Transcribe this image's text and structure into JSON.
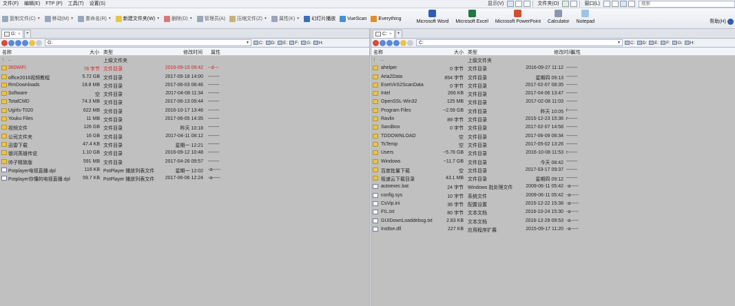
{
  "menu": {
    "items": [
      "文件(F)",
      "编辑(E)",
      "FTP (P)",
      "工具(T)",
      "设置(S)"
    ],
    "right_items": [
      "显示(V)",
      "文件夹(O)",
      "窗口(L)"
    ],
    "search_placeholder": "搜索"
  },
  "toolbar": {
    "buttons": [
      "复制文件(C)",
      "移动(M)",
      "重命名(R)",
      "新建文件夹(W)",
      "删除(D)",
      "管理员(A)",
      "压缩文件(Z)",
      "属性(K)",
      "幻灯片播放",
      "VueScan",
      "Everything"
    ],
    "apps": [
      "Microsoft Word",
      "Microsoft Excel",
      "Microsoft PowerPoint",
      "Calculator",
      "Notepad"
    ],
    "help": "帮助(H)"
  },
  "left": {
    "tab": "G:",
    "path": "G:",
    "drives": [
      "C:",
      "D:",
      "E:",
      "F:",
      "G:",
      "H:"
    ],
    "columns": {
      "name": "名称",
      "size": "大小",
      "type": "类型",
      "time": "修改时间",
      "attr": "属性"
    },
    "rows": [
      {
        "icon": "up",
        "name": "..",
        "size": "",
        "type": "上级文件夹",
        "time": "",
        "attr": "",
        "red": false
      },
      {
        "icon": "folder",
        "name": "360WiFi",
        "size": "78 字节",
        "type": "文件目录",
        "time": "2016-09-15 09:42",
        "attr": "--d---",
        "red": true
      },
      {
        "icon": "folder",
        "name": "office2016视频教程",
        "size": "5.72 GB",
        "type": "文件目录",
        "time": "2017-05-18 14:00",
        "attr": "-------",
        "red": false
      },
      {
        "icon": "folder",
        "name": "RmDownloads",
        "size": "18.8 MB",
        "type": "文件目录",
        "time": "2017-06-03 08:46",
        "attr": "-------",
        "red": false
      },
      {
        "icon": "folder",
        "name": "Software",
        "size": "空",
        "type": "文件目录",
        "time": "2017-04-08 11:34",
        "attr": "-------",
        "red": false
      },
      {
        "icon": "folder",
        "name": "TotalCMD",
        "size": "74.3 MB",
        "type": "文件目录",
        "time": "2017-06-13 09:44",
        "attr": "-------",
        "red": false
      },
      {
        "icon": "folder",
        "name": "Ugirls-T020",
        "size": "622 MB",
        "type": "文件目录",
        "time": "2016-10-17 13:46",
        "attr": "-------",
        "red": false
      },
      {
        "icon": "folder",
        "name": "Youku Files",
        "size": "11 MB",
        "type": "文件目录",
        "time": "2017-06-05 14:35",
        "attr": "-------",
        "red": false
      },
      {
        "icon": "folder",
        "name": "视频文件",
        "size": "126 GB",
        "type": "文件目录",
        "time": "昨天 10:18",
        "attr": "-------",
        "red": false
      },
      {
        "icon": "folder",
        "name": "公司文件夹",
        "size": "16 GB",
        "type": "文件目录",
        "time": "2017-04-11 08:12",
        "attr": "-------",
        "red": false
      },
      {
        "icon": "folder",
        "name": "迅雷下载",
        "size": "47.4 KB",
        "type": "文件目录",
        "time": "星期一 12:21",
        "attr": "-------",
        "red": false
      },
      {
        "icon": "folder",
        "name": "银河英雄传说",
        "size": "1.10 GB",
        "type": "文件目录",
        "time": "2016-09-12 10:48",
        "attr": "-------",
        "red": false
      },
      {
        "icon": "folder",
        "name": "帅子精致版",
        "size": "591 MB",
        "type": "文件目录",
        "time": "2017-04-26 09:57",
        "attr": "-------",
        "red": false
      },
      {
        "icon": "file",
        "name": "Potplayer电视直播.dpl",
        "size": "116 KB",
        "type": "PotPlayer 播放列表文件",
        "time": "星期一 12:02",
        "attr": "-a-----",
        "red": false
      },
      {
        "icon": "file",
        "name": "Potplayer你懂的电视直播.dpl",
        "size": "59.7 KB",
        "type": "PotPlayer 播放列表文件",
        "time": "2017-06-06 12:24",
        "attr": "-a-----",
        "red": false
      }
    ]
  },
  "right": {
    "tab": "C:",
    "path": "C:",
    "drives": [
      "C:",
      "D:",
      "E:",
      "F:",
      "G:",
      "H:"
    ],
    "columns": {
      "name": "名称",
      "size": "大小",
      "type": "类型",
      "time": "修改时间",
      "attr": "属性"
    },
    "rows": [
      {
        "icon": "up",
        "name": "..",
        "size": "",
        "type": "上级文件夹",
        "time": "",
        "attr": ""
      },
      {
        "icon": "folder",
        "name": "ahelper",
        "size": "0 字节",
        "type": "文件目录",
        "time": "2016-09-27 11:12",
        "attr": "-------"
      },
      {
        "icon": "folder",
        "name": "Aria2Data",
        "size": "854 字节",
        "type": "文件目录",
        "time": "星期四 09:13",
        "attr": "-------"
      },
      {
        "icon": "folder",
        "name": "EsetVirS2ScanData",
        "size": "0 字节",
        "type": "文件目录",
        "time": "2017-02-07 08:35",
        "attr": "-------"
      },
      {
        "icon": "folder",
        "name": "Intel",
        "size": "266 KB",
        "type": "文件目录",
        "time": "2017-04-06 13:47",
        "attr": "-------"
      },
      {
        "icon": "folder",
        "name": "OpenSSL-Win32",
        "size": "125 MB",
        "type": "文件目录",
        "time": "2017-02-08 11:03",
        "attr": "-------"
      },
      {
        "icon": "folder",
        "name": "Program Files",
        "size": "~2.59 GB",
        "type": "文件目录",
        "time": "昨天 10:05",
        "attr": "r------"
      },
      {
        "icon": "folder",
        "name": "Ravlin",
        "size": "89 字节",
        "type": "文件目录",
        "time": "2015-12-23 15:36",
        "attr": "r------"
      },
      {
        "icon": "folder",
        "name": "Sandbox",
        "size": "0 字节",
        "type": "文件目录",
        "time": "2017-02-07 14:58",
        "attr": "-------"
      },
      {
        "icon": "folder",
        "name": "TDDOWNLOAD",
        "size": "空",
        "type": "文件目录",
        "time": "2017-06-09 08:34",
        "attr": "-------"
      },
      {
        "icon": "folder",
        "name": "TsTemp",
        "size": "空",
        "type": "文件目录",
        "time": "2017-05-02 13:26",
        "attr": "-------"
      },
      {
        "icon": "folder",
        "name": "Users",
        "size": "~5.78 GB",
        "type": "文件目录",
        "time": "2016-10-08 11:53",
        "attr": "r------"
      },
      {
        "icon": "folder",
        "name": "Windows",
        "size": "~11.7 GB",
        "type": "文件目录",
        "time": "今天 08:42",
        "attr": "-------"
      },
      {
        "icon": "folder",
        "name": "百度批量下载",
        "size": "空",
        "type": "文件目录",
        "time": "2017-03-17 09:37",
        "attr": "-------"
      },
      {
        "icon": "folder",
        "name": "极速云下载目录",
        "size": "43.1 MB",
        "type": "文件目录",
        "time": "星期四 09:12",
        "attr": "-------"
      },
      {
        "icon": "file",
        "name": "autoexec.bat",
        "size": "24 字节",
        "type": "Windows 批处理文件",
        "time": "2009-06-11 05:42",
        "attr": "-a-----"
      },
      {
        "icon": "file",
        "name": "config.sys",
        "size": "10 字节",
        "type": "系统文件",
        "time": "2009-06-11 05:42",
        "attr": "-a-----"
      },
      {
        "icon": "file",
        "name": "CsVip.ini",
        "size": "36 字节",
        "type": "配置设置",
        "time": "2015-12-22 15:38",
        "attr": "-a-----"
      },
      {
        "icon": "file",
        "name": "FIL.txt",
        "size": "80 字节",
        "type": "文本文档",
        "time": "2016-10-24 15:30",
        "attr": "-a-----"
      },
      {
        "icon": "file",
        "name": "GUIDownLoaddebug.txt",
        "size": "2.83 KB",
        "type": "文本文档",
        "time": "2016-12-29 09:53",
        "attr": "-a-----"
      },
      {
        "icon": "file",
        "name": "Instlse.dll",
        "size": "227 KB",
        "type": "应用程序扩展",
        "time": "2015-09-17 11:20",
        "attr": "-a-----"
      }
    ]
  }
}
